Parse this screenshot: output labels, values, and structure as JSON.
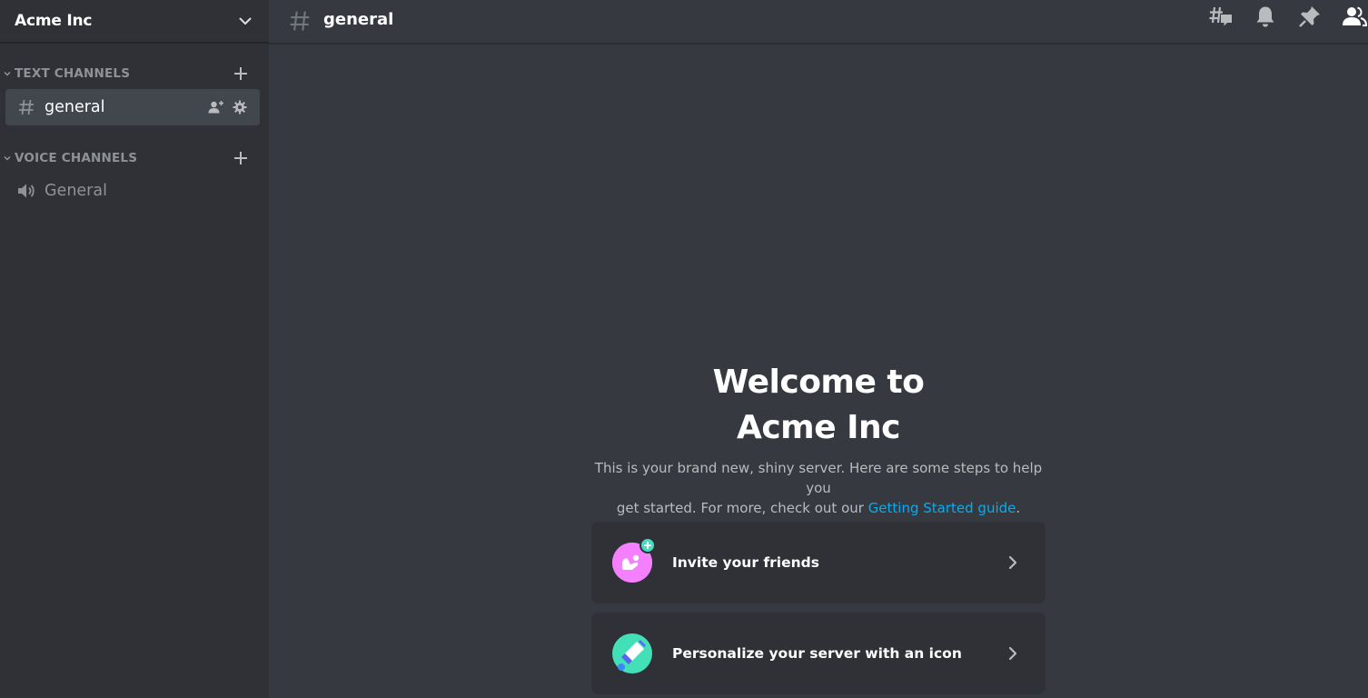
{
  "server": {
    "name": "Acme Inc"
  },
  "sidebar": {
    "text_category": "TEXT CHANNELS",
    "voice_category": "VOICE CHANNELS",
    "text_channels": [
      {
        "name": "general",
        "active": true
      }
    ],
    "voice_channels": [
      {
        "name": "General"
      }
    ]
  },
  "topbar": {
    "channel_name": "general",
    "icons": [
      "threads-icon",
      "bell-icon",
      "pin-icon",
      "members-icon"
    ]
  },
  "welcome": {
    "title_line1": "Welcome to",
    "title_line2": "Acme Inc",
    "desc_line1": "This is your brand new, shiny server. Here are some steps to help you",
    "desc_line2_prefix": "get started. For more, check out our ",
    "desc_link": "Getting Started guide",
    "desc_suffix": "."
  },
  "cards": [
    {
      "label": "Invite your friends",
      "icon": "invite-friends-icon"
    },
    {
      "label": "Personalize your server with an icon",
      "icon": "personalize-icon"
    }
  ],
  "colors": {
    "sidebar_bg": "#2f3136",
    "main_bg": "#36393f",
    "active_channel": "#42464d",
    "link": "#00aff4",
    "invite_pink": "#f47fff",
    "personalize_teal": "#43e0b7"
  }
}
